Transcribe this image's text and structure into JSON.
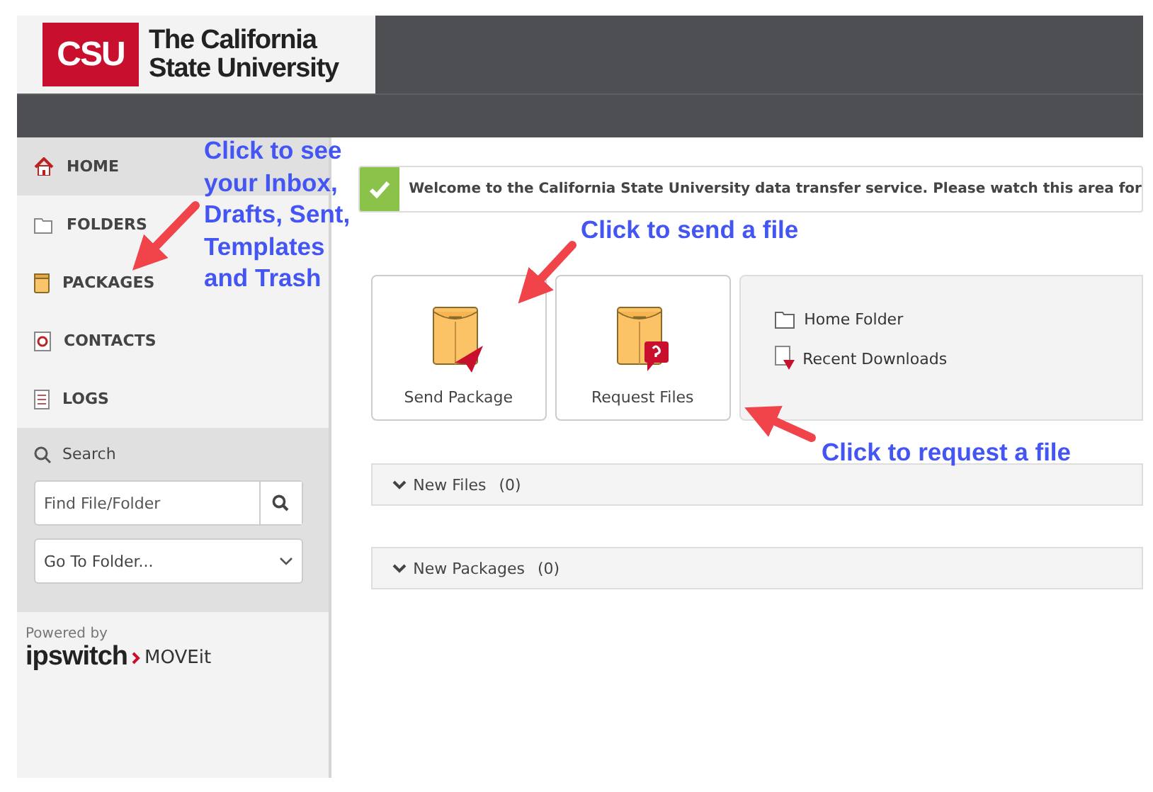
{
  "header": {
    "logo": {
      "mark": "CSU",
      "name_lines": [
        "The California",
        "State University"
      ]
    }
  },
  "sidebar": {
    "items": [
      {
        "label": "HOME",
        "kind": "home",
        "selected": true
      },
      {
        "label": "FOLDERS",
        "kind": "folder",
        "selected": false
      },
      {
        "label": "PACKAGES",
        "kind": "package",
        "selected": false
      },
      {
        "label": "CONTACTS",
        "kind": "contacts",
        "selected": false
      },
      {
        "label": "LOGS",
        "kind": "logs",
        "selected": false
      }
    ],
    "search": {
      "heading": "Search",
      "placeholder": "Find File/Folder",
      "folder_select": "Go To Folder..."
    },
    "powered_by": {
      "caption": "Powered by",
      "brand": "ipswitch",
      "product": "MOVEit"
    }
  },
  "main": {
    "notice": "Welcome to the California State University data transfer service. Please watch this area for",
    "tiles": [
      {
        "label": "Send Package",
        "kind": "send"
      },
      {
        "label": "Request Files",
        "kind": "request"
      }
    ],
    "quick_links": [
      {
        "label": "Home Folder",
        "kind": "folder"
      },
      {
        "label": "Recent Downloads",
        "kind": "download"
      }
    ],
    "sections": [
      {
        "label": "New Files",
        "count": "(0)"
      },
      {
        "label": "New Packages",
        "count": "(0)"
      }
    ]
  },
  "annotations": [
    {
      "text": "Click to see your Inbox, Drafts, Sent, Templates and Trash",
      "kind": "sidebar"
    },
    {
      "text": "Click to send a file",
      "kind": "send"
    },
    {
      "text": "Click to request a file",
      "kind": "request"
    }
  ]
}
